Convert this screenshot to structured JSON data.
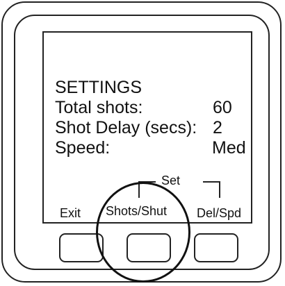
{
  "screen": {
    "title": "SETTINGS",
    "rows": [
      {
        "label": "Total shots:",
        "value": "60"
      },
      {
        "label": "Shot Delay (secs):",
        "value": "2"
      },
      {
        "label": "Speed:",
        "value": "Med"
      }
    ]
  },
  "softkeys": {
    "group_label": "Set",
    "left": "Exit",
    "middle": "Shots/Shut",
    "right": "Del/Spd"
  }
}
